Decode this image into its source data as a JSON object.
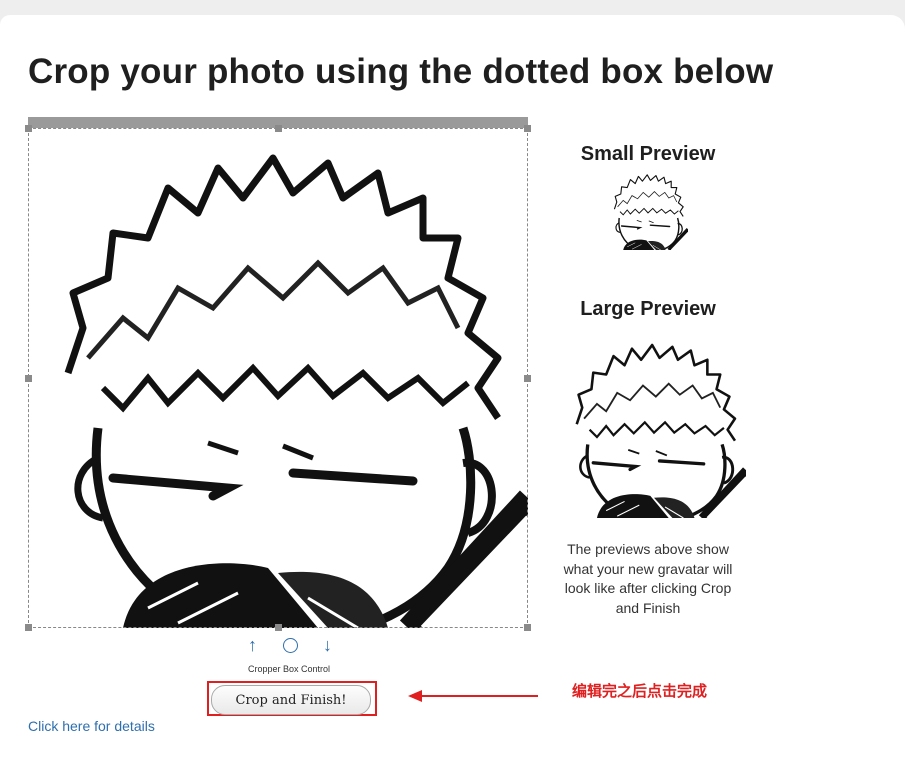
{
  "page": {
    "title": "Crop your photo using the dotted box below"
  },
  "preview": {
    "small_heading": "Small Preview",
    "large_heading": "Large Preview",
    "note": "The previews above show what your new gravatar will look like after clicking Crop and Finish"
  },
  "controls": {
    "up_symbol": "↑",
    "down_symbol": "↓",
    "label": "Cropper Box Control"
  },
  "actions": {
    "crop_button": "Crop and Finish!",
    "details_link": "Click here for details"
  },
  "annotation": {
    "text": "编辑完之后点击完成",
    "color": "#e02020"
  },
  "icons": {
    "control_reset": "circle-icon",
    "control_up": "arrow-up-icon",
    "control_down": "arrow-down-icon"
  },
  "colors": {
    "link": "#2e6fae",
    "annotation": "#e02020"
  }
}
